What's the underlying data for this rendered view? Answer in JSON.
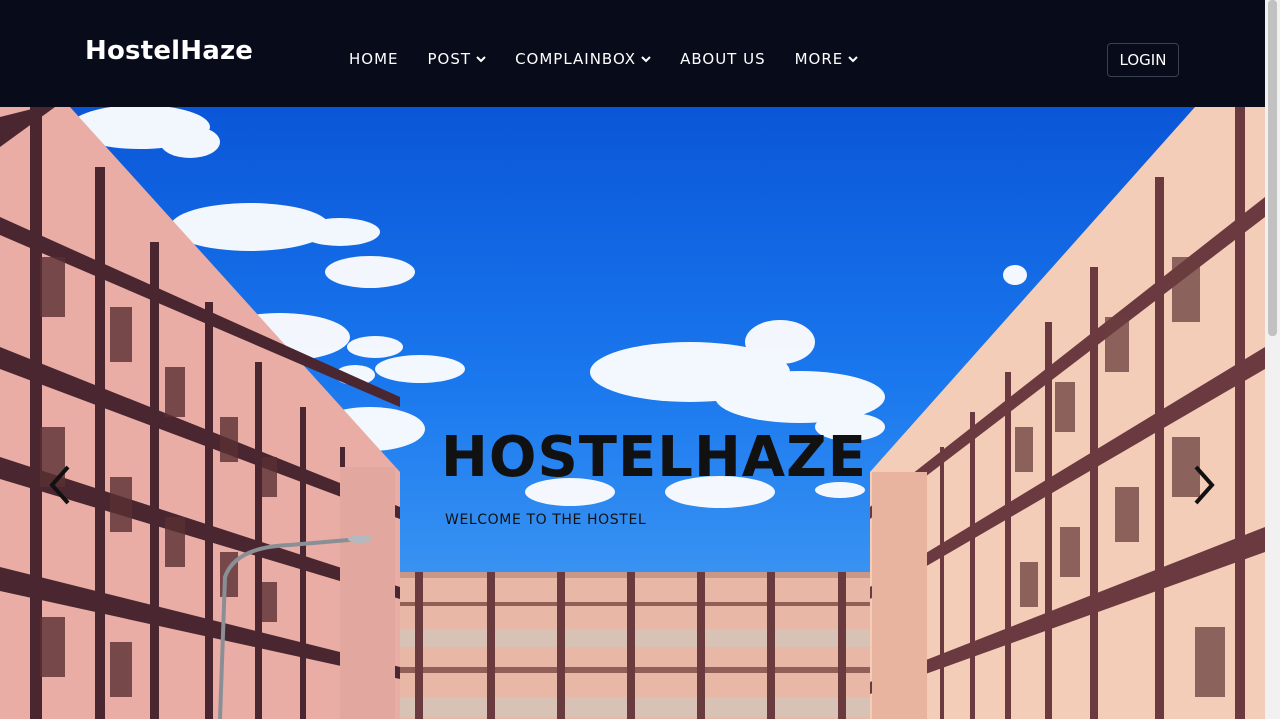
{
  "navbar": {
    "brand": "HostelHaze",
    "items": [
      {
        "label": "HOME",
        "dropdown": false
      },
      {
        "label": "POST",
        "dropdown": true
      },
      {
        "label": "COMPLAINBOX",
        "dropdown": true
      },
      {
        "label": "ABOUT US",
        "dropdown": false
      },
      {
        "label": "MORE",
        "dropdown": true
      }
    ],
    "login_label": "LOGIN"
  },
  "hero": {
    "title": "HOSTELHAZE",
    "subtitle": "WELCOME TO THE HOSTEL",
    "prev_icon": "chevron-left-icon",
    "next_icon": "chevron-right-icon"
  },
  "colors": {
    "navbar_bg": "#080b1a",
    "sky": "#1a78ee",
    "building": "#e8b3a8",
    "building_stripe": "#4a2630"
  }
}
